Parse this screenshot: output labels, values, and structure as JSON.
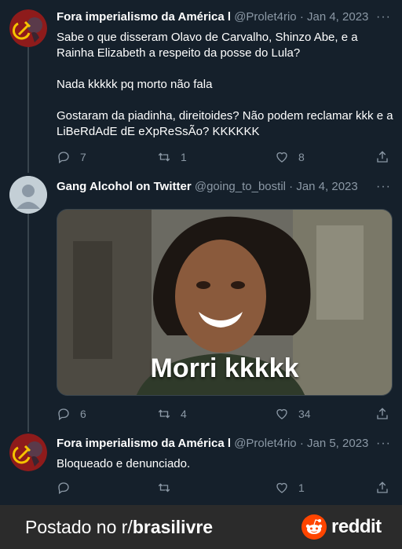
{
  "tweets": [
    {
      "display_name": "Fora imperialismo da América l",
      "handle": "@Prolet4rio",
      "date": "Jan 4, 2023",
      "paragraphs": [
        "Sabe o que disseram Olavo de Carvalho, Shinzo Abe, e a Rainha Elizabeth a respeito da posse do Lula?",
        "Nada kkkkk pq morto não fala",
        "Gostaram da piadinha, direitoides? Não podem reclamar kkk e a LiBeRdAdE dE eXpReSsÃo? KKKKKK"
      ],
      "replies": "7",
      "retweets": "1",
      "likes": "8"
    },
    {
      "display_name": "Gang Alcohol on Twitter",
      "handle": "@going_to_bostil",
      "date": "Jan 4, 2023",
      "image_caption": "Morri kkkkk",
      "replies": "6",
      "retweets": "4",
      "likes": "34"
    },
    {
      "display_name": "Fora imperialismo da América l",
      "handle": "@Prolet4rio",
      "date": "Jan 5, 2023",
      "paragraphs": [
        "Bloqueado e denunciado."
      ],
      "replies": "",
      "retweets": "",
      "likes": "1"
    }
  ],
  "separator": "·",
  "more_glyph": "···",
  "footer": {
    "prefix": "Postado no r/",
    "subreddit": "brasilivre",
    "brand": "reddit"
  },
  "colors": {
    "background": "#15202b",
    "muted": "#8b98a5",
    "footer_bg": "#2b2b2b",
    "reddit_orange": "#ff4500"
  }
}
